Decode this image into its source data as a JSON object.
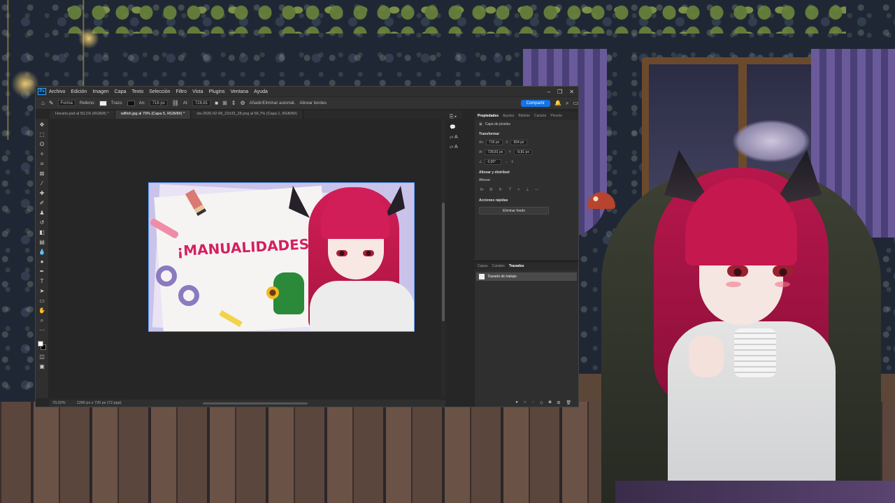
{
  "photoshop": {
    "menu": [
      "Archivo",
      "Edición",
      "Imagen",
      "Capa",
      "Texto",
      "Selección",
      "Filtro",
      "Vista",
      "Plugins",
      "Ventana",
      "Ayuda"
    ],
    "window_controls": [
      "–",
      "❐",
      "✕"
    ],
    "options_bar": {
      "shape_mode": "Forma",
      "fill_label": "Relleno:",
      "stroke_label": "Trazo:",
      "width_label": "An:",
      "width_value": "716 px",
      "height_label": "Al:",
      "height_value": "728,81",
      "auto_add_delete": "Añadir/Eliminar automát.",
      "align_edges": "Alinear bordes",
      "share_label": "Compartir"
    },
    "doc_tabs": [
      {
        "label": "Horario.psd al 50,1% (RGB/8) *",
        "active": false
      },
      {
        "label": "wilfish.jpg al 70% (Capa 5, RGB/8#) *",
        "active": true
      },
      {
        "label": "vts-2026-02-08_21h33_28.png al 66,7% (Capa 1, RGB/8#)",
        "active": false
      }
    ],
    "canvas_title": "¡MANUALIDADES!",
    "status": {
      "zoom": "70,02%",
      "doc_size": "1280 px x 720 px (72 ppp)"
    },
    "side_icons": [
      "A",
      "A"
    ],
    "properties": {
      "tabs": [
        {
          "label": "Propiedades",
          "active": true
        },
        {
          "label": "Ajustes",
          "active": false
        },
        {
          "label": "Bibliote",
          "active": false
        },
        {
          "label": "Carácte",
          "active": false
        },
        {
          "label": "Pincelo",
          "active": false
        }
      ],
      "layer_type": "Capa de píxeles",
      "transform_title": "Transformar",
      "w_label": "An",
      "w_value": "716 px",
      "x_label": "X",
      "x_value": "564 px",
      "h_label": "Al",
      "h_value": "728,81 px",
      "y_label": "Y",
      "y_value": "-9,81 px",
      "angle_value": "0,00°",
      "align_title": "Alinear y distribuir",
      "align_sub": "Alinear:",
      "quick_actions_title": "Acciones rápidas",
      "remove_bg_label": "Eliminar fondo"
    },
    "layers": {
      "tabs": [
        {
          "label": "Capas",
          "active": false
        },
        {
          "label": "Canales",
          "active": false
        },
        {
          "label": "Trazados",
          "active": true
        }
      ],
      "path_item": "Trazado de trabajo"
    }
  }
}
